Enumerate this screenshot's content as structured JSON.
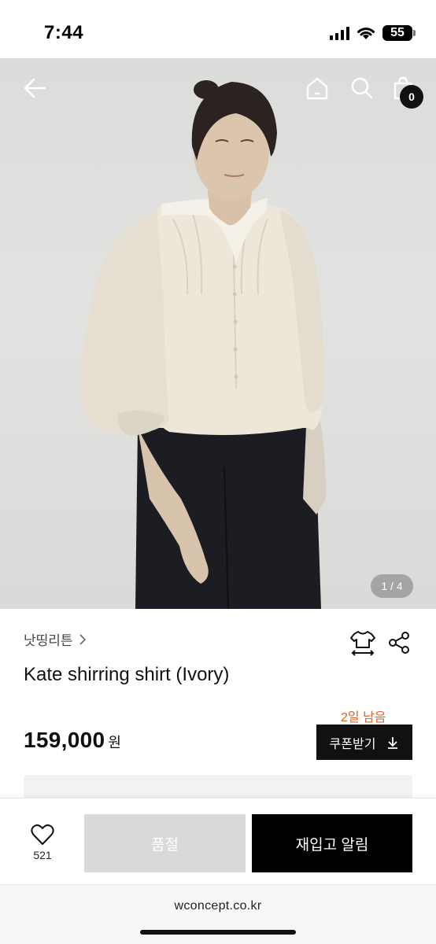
{
  "status_bar": {
    "time": "7:44",
    "battery": "55"
  },
  "nav": {
    "cart_count": "0"
  },
  "gallery": {
    "counter": "1 / 4"
  },
  "product": {
    "brand": "낫띵리튼",
    "title": "Kate shirring shirt (Ivory)",
    "coupon_days_left": "2일 남음",
    "price": "159,000",
    "currency": "원",
    "coupon_button": "쿠폰받기"
  },
  "actions": {
    "like_count": "521",
    "soldout_label": "품절",
    "restock_label": "재입고 알림"
  },
  "browser": {
    "url": "wconcept.co.kr"
  }
}
